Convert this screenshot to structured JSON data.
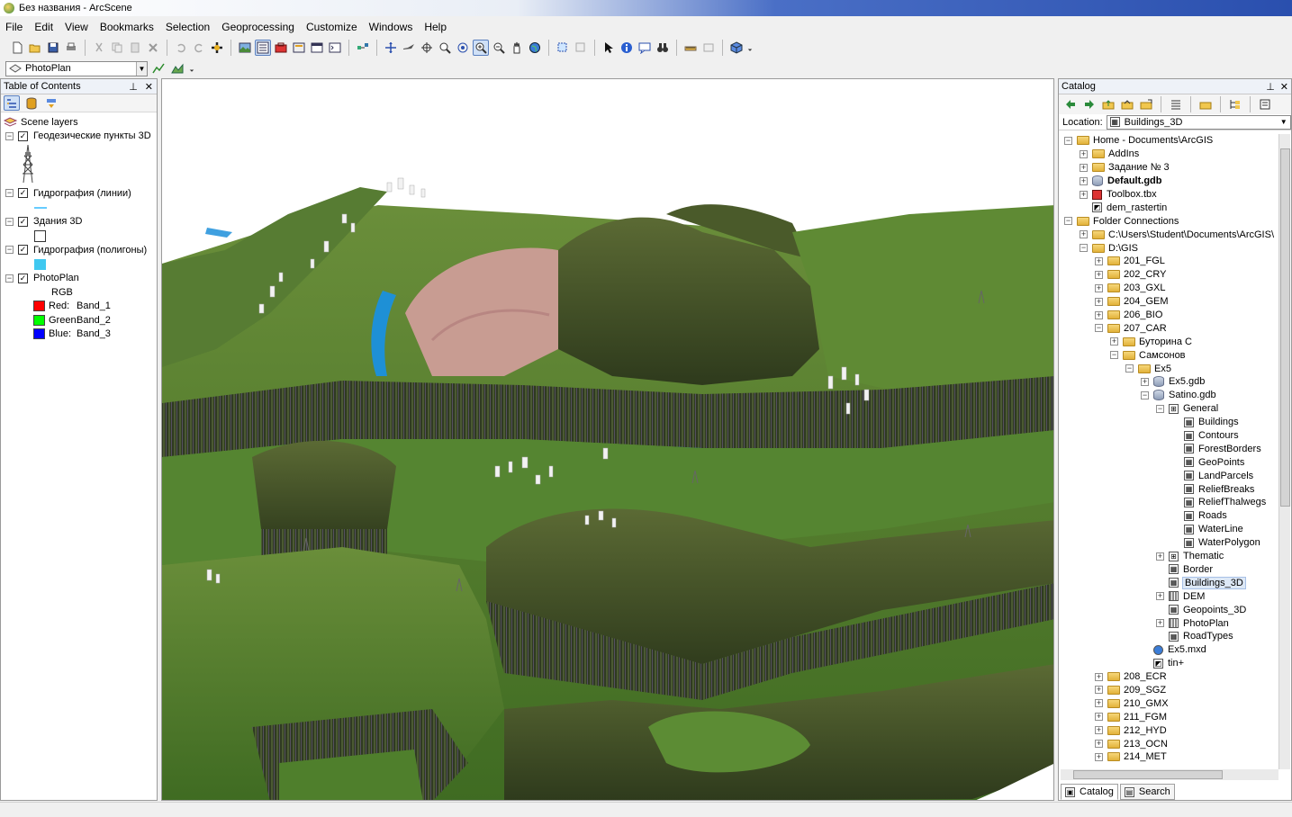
{
  "window": {
    "title": "Без названия - ArcScene"
  },
  "menu": [
    "File",
    "Edit",
    "View",
    "Bookmarks",
    "Selection",
    "Geoprocessing",
    "Customize",
    "Windows",
    "Help"
  ],
  "layer_combo": {
    "value": "PhotoPlan"
  },
  "toc": {
    "title": "Table of Contents",
    "root": "Scene layers",
    "layers": [
      {
        "name": "Геодезические пункты 3D"
      },
      {
        "name": "Гидрография (линии)"
      },
      {
        "name": "Здания 3D"
      },
      {
        "name": "Гидрография (полигоны)"
      },
      {
        "name": "PhotoPlan"
      }
    ],
    "rgb_label": "RGB",
    "bands": [
      {
        "label": "Red:",
        "band": "Band_1",
        "color": "#ff0000"
      },
      {
        "label": "Green:",
        "band": "Band_2",
        "color": "#00ff00"
      },
      {
        "label": "Blue:",
        "band": "Band_3",
        "color": "#0000ff"
      }
    ]
  },
  "catalog": {
    "title": "Catalog",
    "location_label": "Location:",
    "location_value": "Buildings_3D",
    "tree": [
      {
        "d": 0,
        "e": "-",
        "t": "home",
        "label": "Home - Documents\\ArcGIS"
      },
      {
        "d": 1,
        "e": "+",
        "t": "folder",
        "label": "AddIns"
      },
      {
        "d": 1,
        "e": "+",
        "t": "folder",
        "label": "Задание № 3"
      },
      {
        "d": 1,
        "e": "+",
        "t": "gdb",
        "label": "Default.gdb",
        "bold": true
      },
      {
        "d": 1,
        "e": "+",
        "t": "tbx",
        "label": "Toolbox.tbx"
      },
      {
        "d": 1,
        "e": "",
        "t": "tin",
        "label": "dem_rastertin"
      },
      {
        "d": 0,
        "e": "-",
        "t": "folder",
        "label": "Folder Connections"
      },
      {
        "d": 1,
        "e": "+",
        "t": "folder",
        "label": "C:\\Users\\Student\\Documents\\ArcGIS\\"
      },
      {
        "d": 1,
        "e": "-",
        "t": "folder",
        "label": "D:\\GIS"
      },
      {
        "d": 2,
        "e": "+",
        "t": "folder",
        "label": "201_FGL"
      },
      {
        "d": 2,
        "e": "+",
        "t": "folder",
        "label": "202_CRY"
      },
      {
        "d": 2,
        "e": "+",
        "t": "folder",
        "label": "203_GXL"
      },
      {
        "d": 2,
        "e": "+",
        "t": "folder",
        "label": "204_GEM"
      },
      {
        "d": 2,
        "e": "+",
        "t": "folder",
        "label": "206_BIO"
      },
      {
        "d": 2,
        "e": "-",
        "t": "folder",
        "label": "207_CAR"
      },
      {
        "d": 3,
        "e": "+",
        "t": "folder",
        "label": "Буторина С"
      },
      {
        "d": 3,
        "e": "-",
        "t": "folder",
        "label": "Самсонов"
      },
      {
        "d": 4,
        "e": "-",
        "t": "folder",
        "label": "Ex5"
      },
      {
        "d": 5,
        "e": "+",
        "t": "gdb",
        "label": "Ex5.gdb"
      },
      {
        "d": 5,
        "e": "-",
        "t": "gdb",
        "label": "Satino.gdb"
      },
      {
        "d": 6,
        "e": "-",
        "t": "fds",
        "label": "General"
      },
      {
        "d": 7,
        "e": "",
        "t": "fc",
        "label": "Buildings"
      },
      {
        "d": 7,
        "e": "",
        "t": "fc",
        "label": "Contours"
      },
      {
        "d": 7,
        "e": "",
        "t": "fc",
        "label": "ForestBorders"
      },
      {
        "d": 7,
        "e": "",
        "t": "fc",
        "label": "GeoPoints"
      },
      {
        "d": 7,
        "e": "",
        "t": "fc",
        "label": "LandParcels"
      },
      {
        "d": 7,
        "e": "",
        "t": "fc",
        "label": "ReliefBreaks"
      },
      {
        "d": 7,
        "e": "",
        "t": "fc",
        "label": "ReliefThalwegs"
      },
      {
        "d": 7,
        "e": "",
        "t": "fc",
        "label": "Roads"
      },
      {
        "d": 7,
        "e": "",
        "t": "fc",
        "label": "WaterLine"
      },
      {
        "d": 7,
        "e": "",
        "t": "fc",
        "label": "WaterPolygon"
      },
      {
        "d": 6,
        "e": "+",
        "t": "fds",
        "label": "Thematic"
      },
      {
        "d": 6,
        "e": "",
        "t": "fc",
        "label": "Border"
      },
      {
        "d": 6,
        "e": "",
        "t": "fc",
        "label": "Buildings_3D",
        "selected": true
      },
      {
        "d": 6,
        "e": "+",
        "t": "raster",
        "label": "DEM"
      },
      {
        "d": 6,
        "e": "",
        "t": "fc",
        "label": "Geopoints_3D"
      },
      {
        "d": 6,
        "e": "+",
        "t": "raster",
        "label": "PhotoPlan"
      },
      {
        "d": 6,
        "e": "",
        "t": "fc",
        "label": "RoadTypes"
      },
      {
        "d": 5,
        "e": "",
        "t": "mxd",
        "label": "Ex5.mxd"
      },
      {
        "d": 5,
        "e": "",
        "t": "tin",
        "label": "tin+"
      },
      {
        "d": 2,
        "e": "+",
        "t": "folder",
        "label": "208_ECR"
      },
      {
        "d": 2,
        "e": "+",
        "t": "folder",
        "label": "209_SGZ"
      },
      {
        "d": 2,
        "e": "+",
        "t": "folder",
        "label": "210_GMX"
      },
      {
        "d": 2,
        "e": "+",
        "t": "folder",
        "label": "211_FGM"
      },
      {
        "d": 2,
        "e": "+",
        "t": "folder",
        "label": "212_HYD"
      },
      {
        "d": 2,
        "e": "+",
        "t": "folder",
        "label": "213_OCN"
      },
      {
        "d": 2,
        "e": "+",
        "t": "folder",
        "label": "214_MET"
      }
    ],
    "tabs": [
      "Catalog",
      "Search"
    ]
  },
  "colors": {
    "selection": "#dde8f6",
    "water": "#1e90d6",
    "grass": "#4d7a2a",
    "forest": "#3e4a24"
  }
}
